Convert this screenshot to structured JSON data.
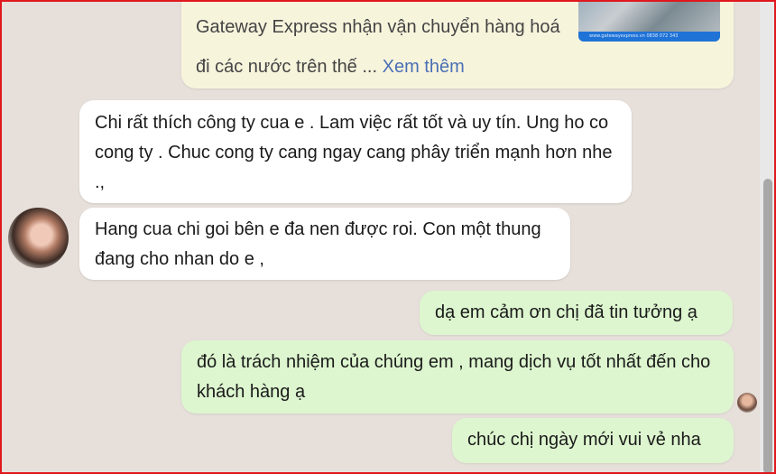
{
  "link_preview": {
    "text": "Gateway Express nhận vận chuyển hàng hoá đi các nước trên thế ...",
    "more_label": "Xem thêm",
    "thumb_footer": "www.gatewayexpress.vn        0838 072 343"
  },
  "messages": [
    {
      "side": "in",
      "text": "Chi rất thích công ty cua e . Lam việc rất tốt và uy tín. Ung ho co cong ty . Chuc cong ty cang ngay cang phây triển mạnh hơn nhe .,"
    },
    {
      "side": "in",
      "text": "Hang cua chi goi bên e đa nen được roi. Con một thung đang cho nhan do e ,"
    },
    {
      "side": "out",
      "text": "dạ em cảm ơn chị đã tin tưởng ạ"
    },
    {
      "side": "out",
      "text": "đó là trách nhiệm của chúng em , mang dịch vụ tốt nhất đến cho khách hàng ạ"
    },
    {
      "side": "out",
      "text": "chúc chị ngày mới vui vẻ nha"
    }
  ],
  "colors": {
    "background": "#e6dfda",
    "incoming_bubble": "#ffffff",
    "outgoing_bubble": "#ddf6cf",
    "link_card": "#f7f4dc",
    "link_accent": "#4a6fb5",
    "frame_border": "#e0181e"
  }
}
